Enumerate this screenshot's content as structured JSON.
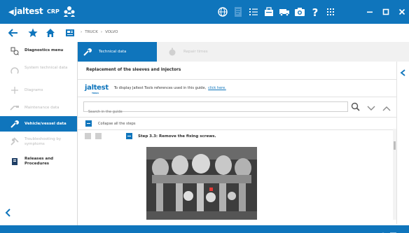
{
  "app": {
    "brand": "jaltest",
    "brand_sub": "",
    "product": "CRP"
  },
  "breadcrumb": [
    "TRUCK",
    "VOLVO"
  ],
  "sidebar": {
    "items": [
      {
        "label": "Diagnostics menu",
        "state": "normal",
        "icon": "diagnostics-icon"
      },
      {
        "label": "System technical data",
        "state": "disabled",
        "icon": "system-data-icon"
      },
      {
        "label": "Diagrams",
        "state": "disabled",
        "icon": "diagrams-icon"
      },
      {
        "label": "Maintenance data",
        "state": "disabled",
        "icon": "maintenance-icon"
      },
      {
        "label": "Vehicle/vessel data",
        "state": "active",
        "icon": "wrench-icon"
      },
      {
        "label": "Troubleshooting by symptoms",
        "state": "disabled",
        "icon": "troubleshooting-icon"
      },
      {
        "label": "Releases and Procedures",
        "state": "normal",
        "icon": "book-icon"
      }
    ]
  },
  "tabs": [
    {
      "label": "Technical data",
      "state": "active"
    },
    {
      "label": "Repair times",
      "state": "inactive"
    }
  ],
  "content": {
    "title": "Replacement of the sleeves and injectors",
    "tools_logo": "jaltest",
    "tools_logo_sub": "TOOLS",
    "tools_text": "To display Jaltest Tools references used in this guide,",
    "tools_link": "click here.",
    "search_placeholder": "Search in the guide",
    "collapse_label": "Collapse all the steps",
    "step_label": "Step 3.3: Remove the fixing screws."
  },
  "colors": {
    "accent": "#0f75bc",
    "disabled_text": "#b9b9b9",
    "tab_bar": "#f1f1f1"
  }
}
